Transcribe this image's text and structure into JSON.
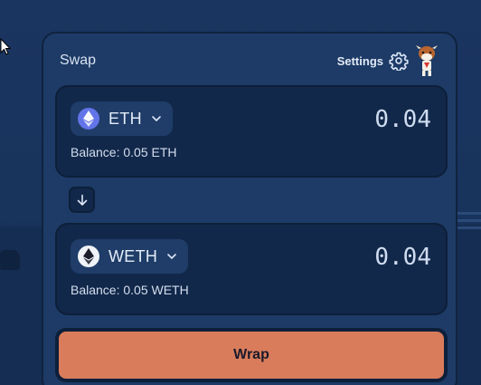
{
  "swap": {
    "title": "Swap",
    "settings_label": "Settings",
    "from": {
      "token_symbol": "ETH",
      "amount": "0.04",
      "balance": "Balance: 0.05 ETH",
      "icon": "ethereum-icon"
    },
    "to": {
      "token_symbol": "WETH",
      "amount": "0.04",
      "balance": "Balance: 0.05 WETH",
      "icon": "weth-icon"
    },
    "action_label": "Wrap"
  },
  "colors": {
    "background": "#1a3560",
    "card": "#1d3b66",
    "panel": "#12284a",
    "accent_button": "#d97c5c",
    "eth_icon": "#6274e8"
  }
}
